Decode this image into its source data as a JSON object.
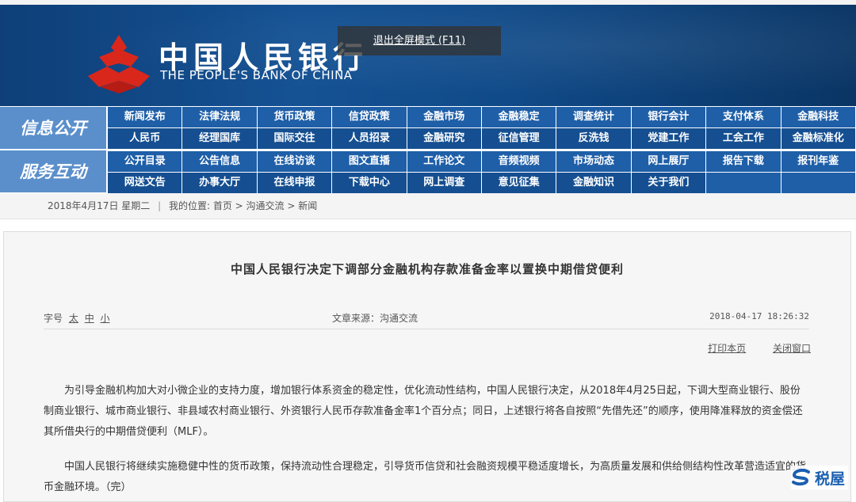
{
  "header": {
    "bank_cn": "中国人民银行",
    "bank_en": "THE PEOPLE'S BANK OF CHINA",
    "fullscreen_tip": "退出全屏模式 (F11)"
  },
  "nav": {
    "side_labels": [
      "信息公开",
      "服务互动"
    ],
    "rows": [
      [
        "新闻发布",
        "法律法规",
        "货币政策",
        "信贷政策",
        "金融市场",
        "金融稳定",
        "调查统计",
        "银行会计",
        "支付体系",
        "金融科技"
      ],
      [
        "人民币",
        "经理国库",
        "国际交往",
        "人员招录",
        "金融研究",
        "征信管理",
        "反洗钱",
        "党建工作",
        "工会工作",
        "金融标准化"
      ],
      [
        "公开目录",
        "公告信息",
        "在线访谈",
        "图文直播",
        "工作论文",
        "音频视频",
        "市场动态",
        "网上展厅",
        "报告下载",
        "报刊年鉴"
      ],
      [
        "网送文告",
        "办事大厅",
        "在线申报",
        "下载中心",
        "网上调查",
        "意见征集",
        "金融知识",
        "关于我们",
        "",
        ""
      ]
    ]
  },
  "breadcrumb": {
    "date": "2018年4月17日 星期二",
    "separator": "|",
    "location_label": "我的位置:",
    "path": "首页 > 沟通交流 > 新闻"
  },
  "article": {
    "title": "中国人民银行决定下调部分金融机构存款准备金率以置换中期借贷便利",
    "font_size_label": "字号",
    "font_sizes": [
      "太",
      "中",
      "小"
    ],
    "source": "文章来源：沟通交流",
    "datetime": "2018-04-17 18:26:32",
    "print_label": "打印本页",
    "close_label": "关闭窗口",
    "paragraphs": [
      "为引导金融机构加大对小微企业的支持力度，增加银行体系资金的稳定性，优化流动性结构，中国人民银行决定，从2018年4月25日起，下调大型商业银行、股份制商业银行、城市商业银行、非县域农村商业银行、外资银行人民币存款准备金率1个百分点；同日，上述银行将各自按照“先借先还”的顺序，使用降准释放的资金偿还其所借央行的中期借贷便利（MLF）。",
      "中国人民银行将继续实施稳健中性的货币政策，保持流动性合理稳定，引导货币信贷和社会融资规模平稳适度增长，为高质量发展和供给侧结构性改革营造适宜的货币金融环境。（完）"
    ]
  },
  "watermark": {
    "text": "税屋"
  },
  "colors": {
    "banner_blue": "#155294",
    "nav_blue": "#1f5fa8",
    "side_blue": "#5b8fcc"
  }
}
